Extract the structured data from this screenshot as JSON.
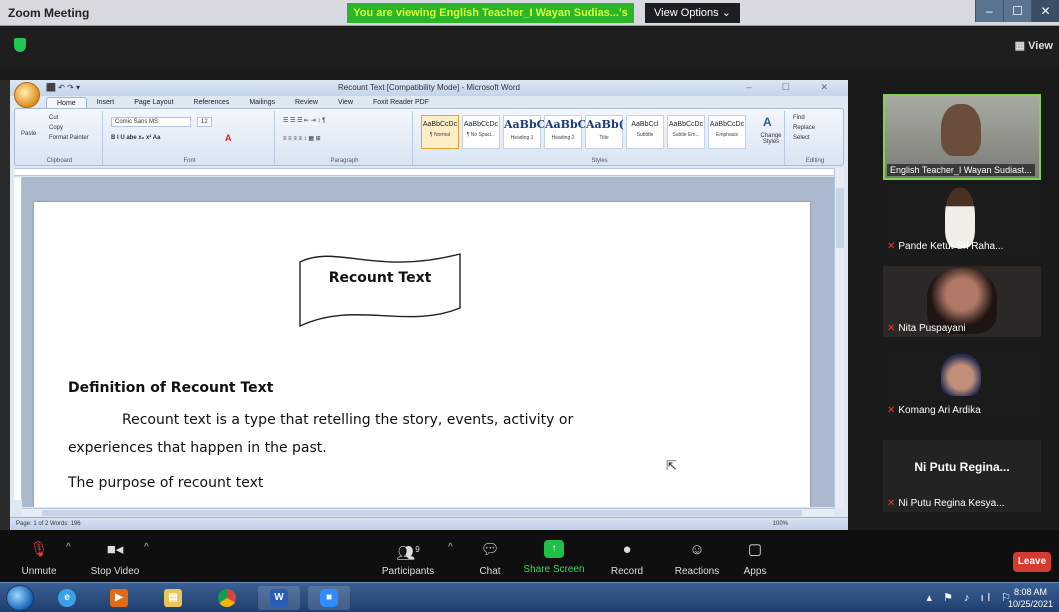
{
  "zoom_window": {
    "title": "Zoom Meeting",
    "viewing_banner": "You are viewing English Teacher_I Wayan Sudias...'s screen",
    "view_options": "View Options ⌄",
    "view_button": "View",
    "window_buttons": [
      "–",
      "☐",
      "✕"
    ]
  },
  "word": {
    "window_title": "Recount Text [Compatibility Mode] - Microsoft Word",
    "quick_access": "⬛ ↶ ↷ ▾",
    "tabs": [
      "Home",
      "Insert",
      "Page Layout",
      "References",
      "Mailings",
      "Review",
      "View",
      "Foxit Reader PDF"
    ],
    "ribbon": {
      "clipboard": {
        "name": "Clipboard",
        "items": [
          "Cut",
          "Copy",
          "Format Painter",
          "Paste"
        ]
      },
      "font": {
        "name": "Font",
        "font_name": "Comic Sans MS",
        "font_size": "12",
        "buttons": "B  I  U  abe  x₂  x²  Aa"
      },
      "paragraph": {
        "name": "Paragraph"
      },
      "styles": {
        "name": "Styles",
        "items": [
          {
            "sample": "AaBbCcDc",
            "label": "¶ Normal",
            "big": false
          },
          {
            "sample": "AaBbCcDc",
            "label": "¶ No Spaci...",
            "big": false
          },
          {
            "sample": "AaBbC",
            "label": "Heading 1",
            "big": true
          },
          {
            "sample": "AaBbC",
            "label": "Heading 2",
            "big": true
          },
          {
            "sample": "AaBb(",
            "label": "Title",
            "big": true
          },
          {
            "sample": "AaBbCcl",
            "label": "Subtitle",
            "big": false
          },
          {
            "sample": "AaBbCcDc",
            "label": "Subtle Em...",
            "big": false
          },
          {
            "sample": "AaBbCcDc",
            "label": "Emphasis",
            "big": false
          }
        ],
        "change_styles": "Change Styles"
      },
      "editing": {
        "name": "Editing",
        "items": [
          "Find",
          "Replace",
          "Select"
        ]
      }
    },
    "document": {
      "banner_title": "Recount Text",
      "definition_heading": "Definition of Recount Text",
      "definition_line1": "Recount text is a type that retelling the story, events, activity or",
      "definition_line2": "experiences that happen in the past.",
      "purpose_heading": "The purpose of recount text"
    },
    "status": {
      "page": "Page: 1 of 2    Words: 196",
      "zoom": "100%"
    }
  },
  "participants": [
    {
      "name": "English Teacher_I Wayan Sudiast...",
      "muted": false,
      "video": true,
      "active": true
    },
    {
      "name": "Pande Ketut Sri Raha...",
      "muted": true,
      "video": true,
      "active": false
    },
    {
      "name": "Nita Puspayani",
      "muted": true,
      "video": true,
      "active": false
    },
    {
      "name": "Komang Ari Ardika",
      "muted": true,
      "video": true,
      "active": false
    },
    {
      "name": "Ni Putu Regina Kesya...",
      "display_name": "Ni Putu Regina...",
      "muted": true,
      "video": false,
      "active": false
    }
  ],
  "controls": {
    "unmute": "Unmute",
    "stop_video": "Stop Video",
    "participants": "Participants",
    "participants_count": "9",
    "chat": "Chat",
    "share_screen": "Share Screen",
    "record": "Record",
    "reactions": "Reactions",
    "apps": "Apps",
    "leave": "Leave"
  },
  "taskbar": {
    "time": "8:08 AM",
    "date": "10/25/2021",
    "apps": [
      "ie-icon",
      "media-player-icon",
      "file-explorer-icon",
      "chrome-icon",
      "word-icon",
      "zoom-icon"
    ]
  },
  "colors": {
    "zoom_green": "#2bb52b",
    "active_speaker": "#7fd44b",
    "leave_red": "#d63b2f",
    "muted_red": "#e23b3b"
  }
}
